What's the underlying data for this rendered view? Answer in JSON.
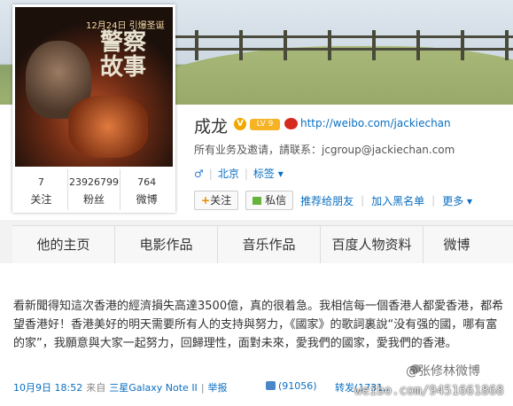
{
  "avatar": {
    "date": "12月24日 引爆圣诞",
    "title": "警察故事"
  },
  "profile": {
    "name": "成龙",
    "badge": "V",
    "level": "LV 9",
    "url": "http://weibo.com/jackiechan",
    "biz": "所有业务及邀请，請联系：jcgroup@jackiechan.com",
    "gender": "♂",
    "location": "北京",
    "tags": "标签 ▾"
  },
  "stats": [
    {
      "value": "7",
      "label": "关注"
    },
    {
      "value": "23926799",
      "label": "粉丝"
    },
    {
      "value": "764",
      "label": "微博"
    }
  ],
  "actions": {
    "follow": "关注",
    "follow_plus": "+",
    "message": "私信",
    "recommend": "推荐给朋友",
    "blacklist": "加入黑名单",
    "more": "更多 ▾"
  },
  "tabs": [
    "他的主页",
    "电影作品",
    "音乐作品",
    "百度人物资料",
    "微博"
  ],
  "post": {
    "text": "看新聞得知這次香港的經濟損失高達3500億，真的很着急。我相信每一個香港人都愛香港，都希望香港好！香港美好的明天需要所有人的支持與努力，《國家》的歌詞裏說“没有强的國，哪有富的家”，我願意與大家一起努力，回歸理性，面對未來，愛我們的國家，愛我們的香港。",
    "time": "10月9日 18:52",
    "from": "来自",
    "device": "三星Galaxy Note II",
    "report": "举报",
    "likes": "(91056)",
    "repost": "转发(1731..."
  },
  "watermark": {
    "handle": "@张修林微博",
    "url": "weibo.com/9451661868"
  },
  "colors": {
    "link": "#0a6fc1",
    "badge": "#f0a800",
    "weibo_red": "#d52b1e"
  }
}
